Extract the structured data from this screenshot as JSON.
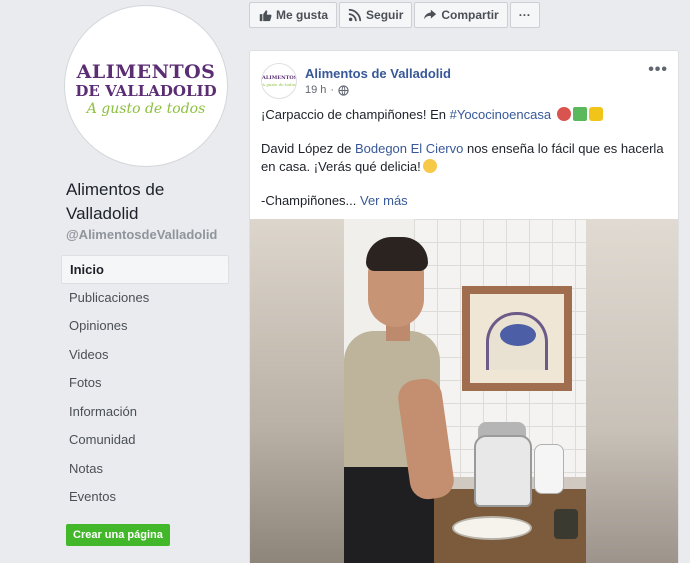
{
  "sidebar": {
    "logo": {
      "line1": "ALIMENTOS",
      "line2": "DE VALLADOLID",
      "line3": "A gusto de todos"
    },
    "page_name": "Alimentos de Valladolid",
    "handle": "@AlimentosdeValladolid",
    "nav": [
      {
        "label": "Inicio",
        "active": true
      },
      {
        "label": "Publicaciones"
      },
      {
        "label": "Opiniones"
      },
      {
        "label": "Videos"
      },
      {
        "label": "Fotos"
      },
      {
        "label": "Información"
      },
      {
        "label": "Comunidad"
      },
      {
        "label": "Notas"
      },
      {
        "label": "Eventos"
      }
    ],
    "create_page": "Crear una página"
  },
  "actions": {
    "like": "Me gusta",
    "follow": "Seguir",
    "share": "Compartir",
    "more": "···"
  },
  "post": {
    "author": "Alimentos de Valladolid",
    "time": "19 h",
    "more": "•••",
    "line1_prefix": "¡Carpaccio de champiñones! En ",
    "hashtag": "#Yococinoencasa",
    "line2_prefix": "David López de ",
    "mention": "Bodegon El Ciervo",
    "line2_suffix": " nos enseña lo fácil que es hacerla en casa. ¡Verás qué delicia!",
    "line3": "-Champiñones... ",
    "see_more": "Ver más"
  },
  "colors": {
    "link": "#385898",
    "accent_green": "#42b72a",
    "brand_purple": "#5b2d73"
  },
  "icons": [
    "thumbs-up-icon",
    "rss-icon",
    "share-icon",
    "globe-icon",
    "mushroom-emoji",
    "sprout-emoji",
    "cheese-emoji",
    "smile-emoji"
  ]
}
